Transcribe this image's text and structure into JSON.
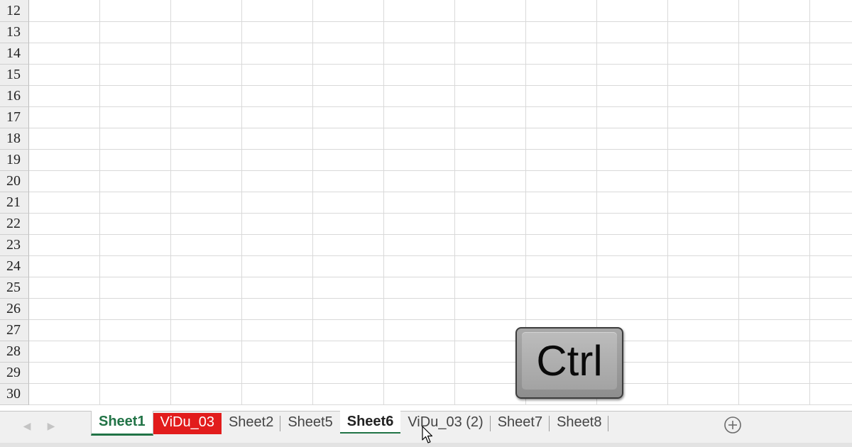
{
  "grid": {
    "row_numbers": [
      "12",
      "13",
      "14",
      "15",
      "16",
      "17",
      "18",
      "19",
      "20",
      "21",
      "22",
      "23",
      "24",
      "25",
      "26",
      "27",
      "28",
      "29",
      "30"
    ],
    "column_count": 12
  },
  "sheet_tabs": [
    {
      "label": "Sheet1",
      "state": "active"
    },
    {
      "label": "ViDu_03",
      "state": "red"
    },
    {
      "label": "Sheet2",
      "state": "normal"
    },
    {
      "label": "Sheet5",
      "state": "normal"
    },
    {
      "label": "Sheet6",
      "state": "grouped"
    },
    {
      "label": "ViDu_03 (2)",
      "state": "normal"
    },
    {
      "label": "Sheet7",
      "state": "normal"
    },
    {
      "label": "Sheet8",
      "state": "normal"
    }
  ],
  "navigation": {
    "prev_icon": "chevron-left-icon",
    "next_icon": "chevron-right-icon",
    "add_sheet_icon": "plus-circle-icon"
  },
  "key_overlay": {
    "label": "Ctrl"
  },
  "colors": {
    "active_tab_text": "#217346",
    "red_tab_background": "#e21c1c",
    "tab_bar_background": "#f0f0f0",
    "gridline": "#d9d9d9",
    "row_header_background": "#eeeeee"
  }
}
